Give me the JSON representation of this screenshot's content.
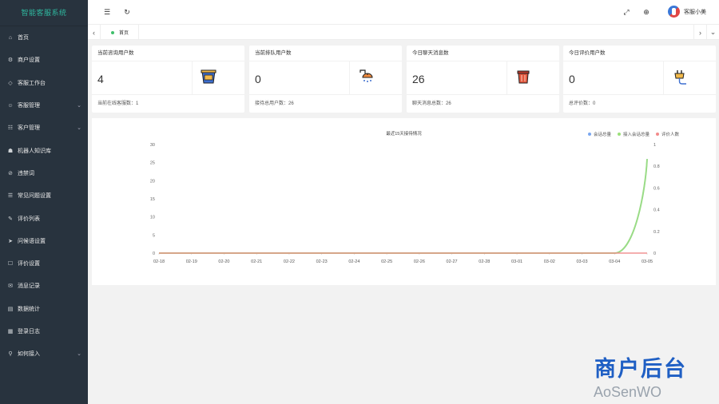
{
  "sidebar": {
    "title": "智能客服系统",
    "items": [
      {
        "label": "首页",
        "icon": "home-icon",
        "glyph": "⌂",
        "expandable": false
      },
      {
        "label": "商户设置",
        "icon": "settings-icon",
        "glyph": "⚙",
        "expandable": false
      },
      {
        "label": "客服工作台",
        "icon": "workbench-icon",
        "glyph": "◇",
        "expandable": false
      },
      {
        "label": "客服管理",
        "icon": "user-icon",
        "glyph": "☺",
        "expandable": true
      },
      {
        "label": "客户管理",
        "icon": "group-icon",
        "glyph": "☷",
        "expandable": true
      },
      {
        "label": "机器人知识库",
        "icon": "robot-icon",
        "glyph": "☗",
        "expandable": false
      },
      {
        "label": "违禁词",
        "icon": "block-icon",
        "glyph": "⊘",
        "expandable": false
      },
      {
        "label": "常见问题设置",
        "icon": "faq-icon",
        "glyph": "☰",
        "expandable": false
      },
      {
        "label": "评价列表",
        "icon": "comment-icon",
        "glyph": "✎",
        "expandable": false
      },
      {
        "label": "问候语设置",
        "icon": "send-icon",
        "glyph": "➤",
        "expandable": false
      },
      {
        "label": "评价设置",
        "icon": "form-icon",
        "glyph": "☐",
        "expandable": false
      },
      {
        "label": "消息记录",
        "icon": "message-icon",
        "glyph": "✉",
        "expandable": false
      },
      {
        "label": "数据统计",
        "icon": "stats-icon",
        "glyph": "▤",
        "expandable": false
      },
      {
        "label": "登录日志",
        "icon": "log-icon",
        "glyph": "▦",
        "expandable": false
      },
      {
        "label": "如何接入",
        "icon": "link-icon",
        "glyph": "⚲",
        "expandable": true
      }
    ]
  },
  "header": {
    "menu_icon": "menu-icon",
    "refresh_icon": "refresh-icon",
    "fullscreen_icon": "fullscreen-icon",
    "lang_icon": "globe-icon",
    "username": "客服小美"
  },
  "tabs": {
    "home_label": "首页",
    "active_color": "#3fbf6b"
  },
  "cards": [
    {
      "title": "当前咨询用户数",
      "value": "4",
      "footer": "当前在线客服数：1",
      "icon": "bucket-icon"
    },
    {
      "title": "当前排队用户数",
      "value": "0",
      "footer": "接待总用户数：26",
      "icon": "shower-icon"
    },
    {
      "title": "今日聊天消息数",
      "value": "26",
      "footer": "聊天消息总数：26",
      "icon": "trash-icon"
    },
    {
      "title": "今日评价用户数",
      "value": "0",
      "footer": "总评价数：0",
      "icon": "plug-icon"
    }
  ],
  "chart_data": {
    "type": "line",
    "title": "最近15天接待情况",
    "categories": [
      "02-18",
      "02-19",
      "02-20",
      "02-21",
      "02-22",
      "02-23",
      "02-24",
      "02-25",
      "02-26",
      "02-27",
      "02-28",
      "03-01",
      "03-02",
      "03-03",
      "03-04",
      "03-05"
    ],
    "ylim_left": [
      0,
      30
    ],
    "yticks_left": [
      0,
      5,
      10,
      15,
      20,
      25,
      30
    ],
    "ylim_right": [
      0,
      1
    ],
    "yticks_right": [
      "0",
      "0.2",
      "0.4",
      "0.6",
      "0.8",
      "1"
    ],
    "legend_position": "top-right",
    "series": [
      {
        "name": "会话总量",
        "color": "#7aa7f0",
        "axis": "left",
        "values": [
          0,
          0,
          0,
          0,
          0,
          0,
          0,
          0,
          0,
          0,
          0,
          0,
          0,
          0,
          0,
          26
        ]
      },
      {
        "name": "接入会话总量",
        "color": "#9be07a",
        "axis": "left",
        "values": [
          0,
          0,
          0,
          0,
          0,
          0,
          0,
          0,
          0,
          0,
          0,
          0,
          0,
          0,
          0,
          26
        ]
      },
      {
        "name": "评价人数",
        "color": "#f28b8b",
        "axis": "right",
        "values": [
          0,
          0,
          0,
          0,
          0,
          0,
          0,
          0,
          0,
          0,
          0,
          0,
          0,
          0,
          0,
          0
        ]
      }
    ]
  },
  "branding": {
    "cn": "商户后台",
    "en": "AoSenWO"
  }
}
